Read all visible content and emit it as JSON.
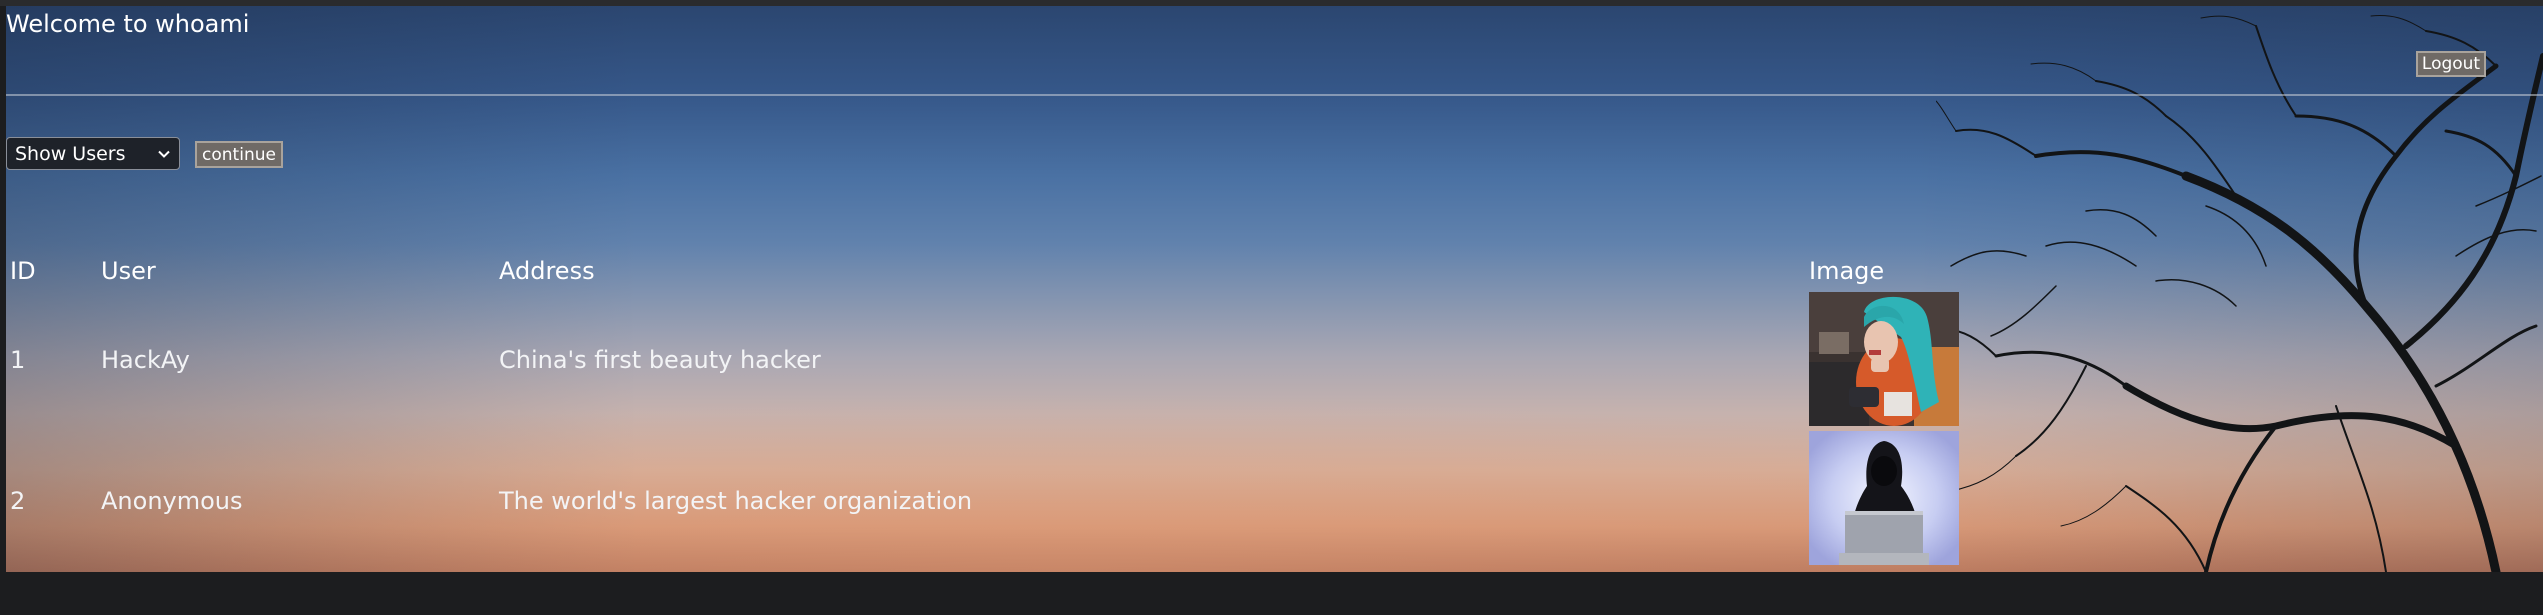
{
  "header": {
    "welcome_text": "Welcome to whoami",
    "logout_label": "Logout"
  },
  "controls": {
    "selected_option": "Show Users",
    "continue_label": "continue"
  },
  "table": {
    "columns": [
      "ID",
      "User",
      "Address",
      "Image"
    ],
    "rows": [
      {
        "id": "1",
        "user": "HackAy",
        "address": "China's first beauty hacker",
        "image": "hacker-portrait-image"
      },
      {
        "id": "2",
        "user": "Anonymous",
        "address": "The world's largest hacker organization",
        "image": "hooded-hacker-laptop-image"
      }
    ]
  },
  "background": {
    "description_icon": "sunset-tree-background"
  }
}
